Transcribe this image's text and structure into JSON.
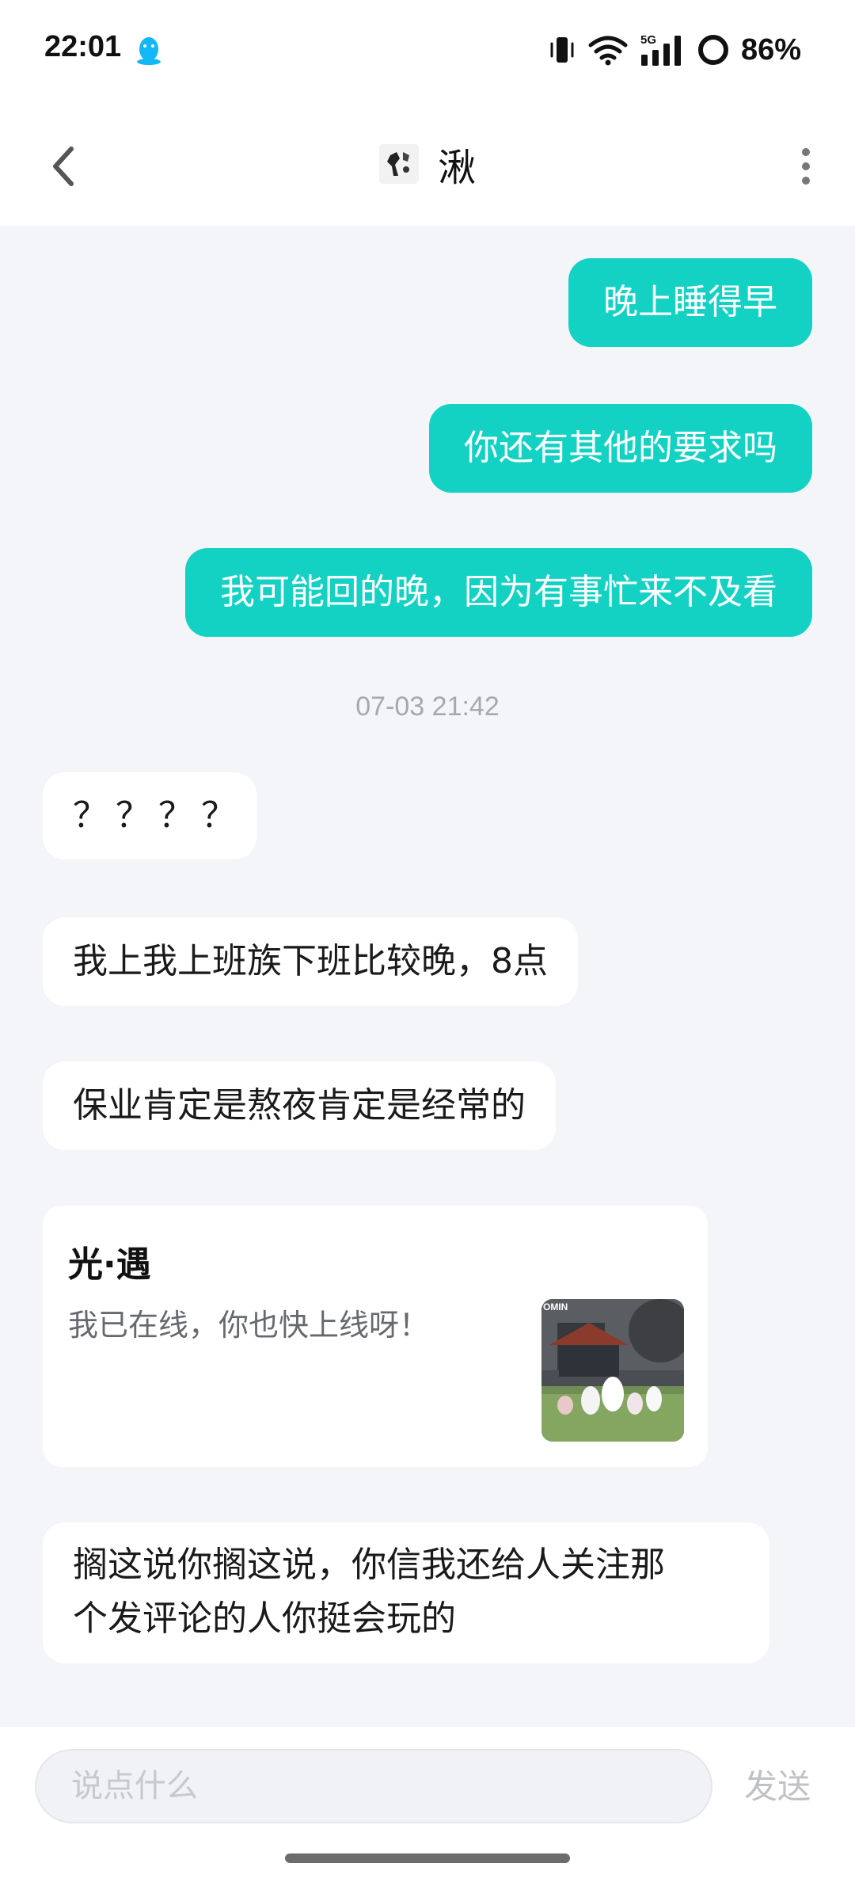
{
  "status_bar": {
    "time": "22:01",
    "battery": "86%",
    "network": "5G"
  },
  "header": {
    "title": "湫"
  },
  "messages_out": [
    {
      "text": "晚上睡得早"
    },
    {
      "text": "你还有其他的要求吗"
    },
    {
      "text": "我可能回的晚，因为有事忙来不及看"
    }
  ],
  "timestamp": "07-03 21:42",
  "messages_in": [
    {
      "text": "？？？？"
    },
    {
      "text": "我上我上班族下班比较晚，8点"
    },
    {
      "text": "保业肯定是熬夜肯定是经常的"
    },
    {
      "text_line1": "搁这说你搁这说，你信我还给人关注那",
      "text_line2": "个发评论的人你挺会玩的"
    }
  ],
  "share_card": {
    "title": "光·遇",
    "description": "我已在线，你也快上线呀！",
    "thumb_label": "OMIN"
  },
  "composer": {
    "placeholder": "说点什么",
    "send_label": "发送"
  },
  "colors": {
    "outgoing_bubble": "#13d1c3",
    "background": "#f4f5f8",
    "qq_icon": "#12b7f5"
  },
  "icons": {
    "back": "chevron-left-icon",
    "more": "more-vertical-icon",
    "qq": "qq-penguin-icon",
    "vibrate": "vibrate-icon",
    "wifi": "wifi-icon",
    "cellular": "cellular-5g-icon",
    "battery": "battery-ring-icon"
  }
}
